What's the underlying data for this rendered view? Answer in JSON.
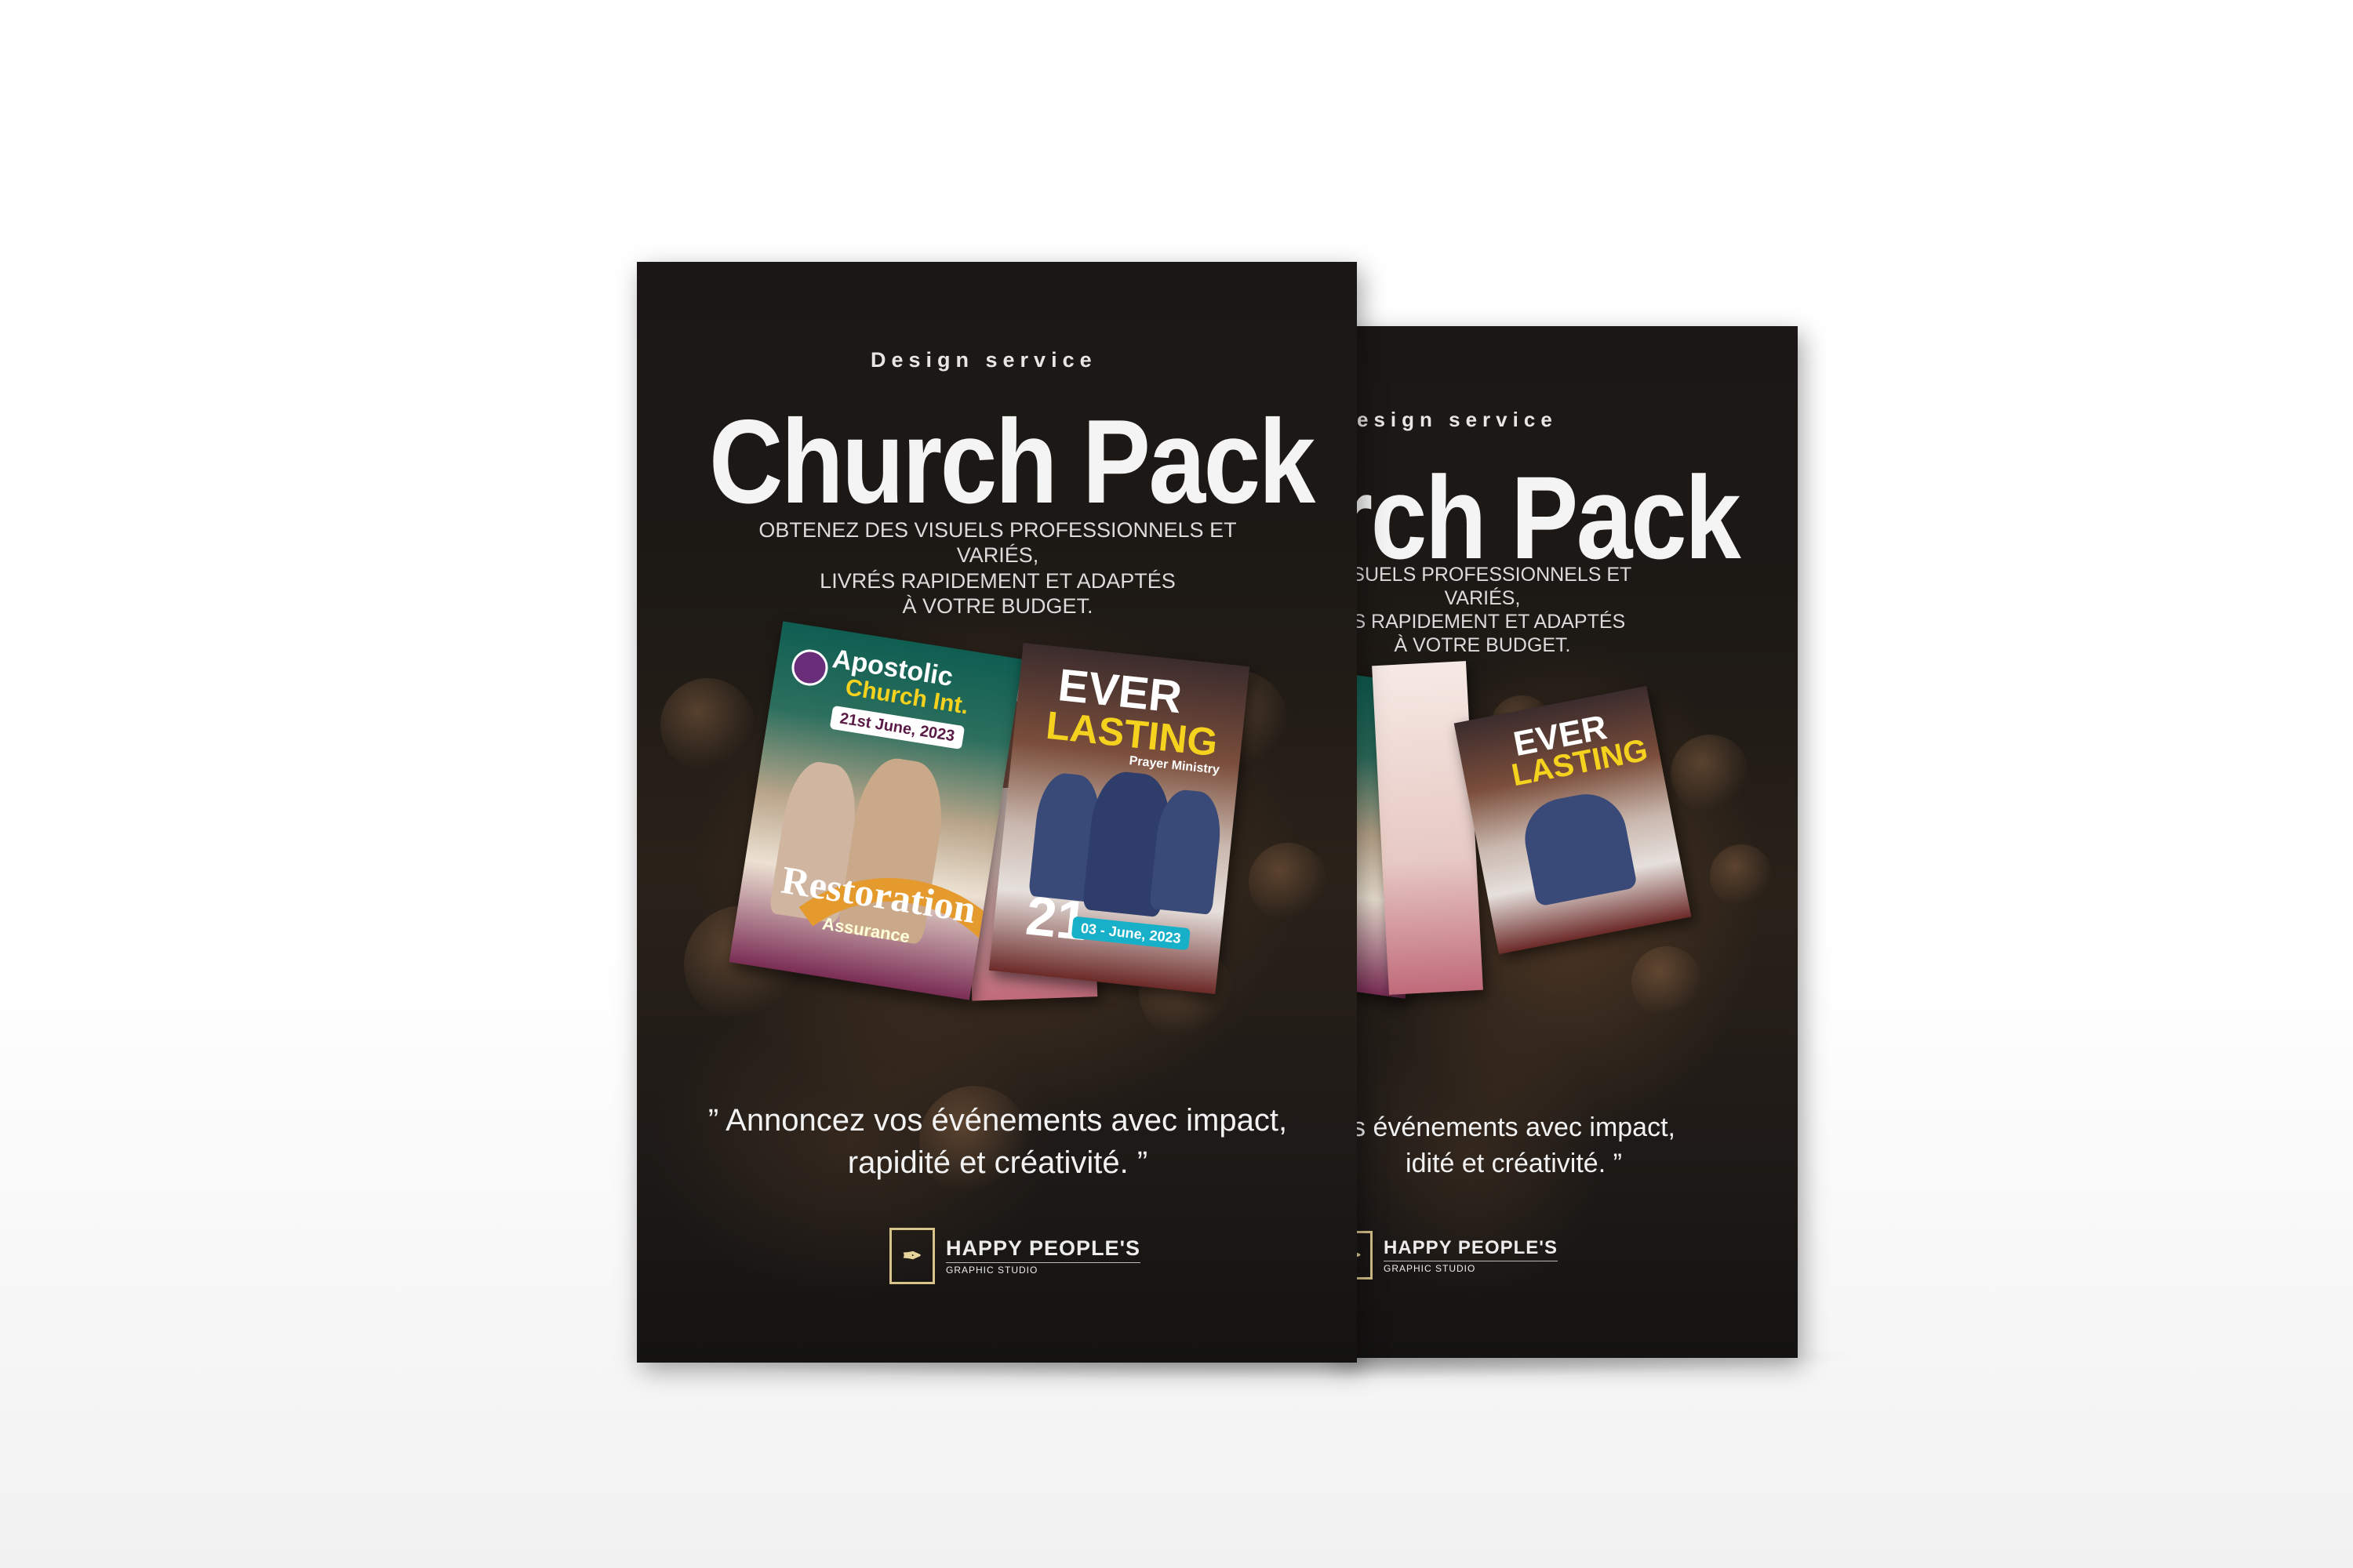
{
  "flyer": {
    "kicker": "Design service",
    "title": "Church Pack",
    "subtitle_lines": [
      "OBTENEZ DES VISUELS PROFESSIONNELS ET VARIÉS,",
      "LIVRÉS RAPIDEMENT ET ADAPTÉS",
      "À VOTRE BUDGET."
    ],
    "quote_lines": [
      "” Annoncez vos événements avec impact,",
      "rapidité et créativité. ”"
    ],
    "brand": {
      "name": "HAPPY PEOPLE'S",
      "tagline": "GRAPHIC STUDIO"
    }
  },
  "back_flyer": {
    "kicker": "esign service",
    "title": "rch Pack",
    "subtitle_lines": [
      "VISUELS PROFESSIONNELS ET VARIÉS,",
      "ÉS RAPIDEMENT ET ADAPTÉS",
      "À VOTRE BUDGET."
    ],
    "quote_lines": [
      "s événements avec impact,",
      "idité et créativité. ”"
    ]
  },
  "samples": {
    "apostolic": {
      "title_line1": "Apostolic",
      "title_line2": "Church Int.",
      "date": "21st June, 2023",
      "headline": "Restoration",
      "tagline": "Assurance"
    },
    "everlasting": {
      "title_line1": "EVER",
      "title_line2": "LASTING",
      "tagline": "Prayer Ministry",
      "number": "21",
      "date": "03 - June, 2023"
    }
  },
  "colors": {
    "flyer_bg": "#1a1716",
    "accent_gold": "#d8c38a",
    "ever_yellow": "#f5d21e",
    "apostolic_teal": "#0f5e52",
    "restoration_orange": "#e59a2d"
  }
}
